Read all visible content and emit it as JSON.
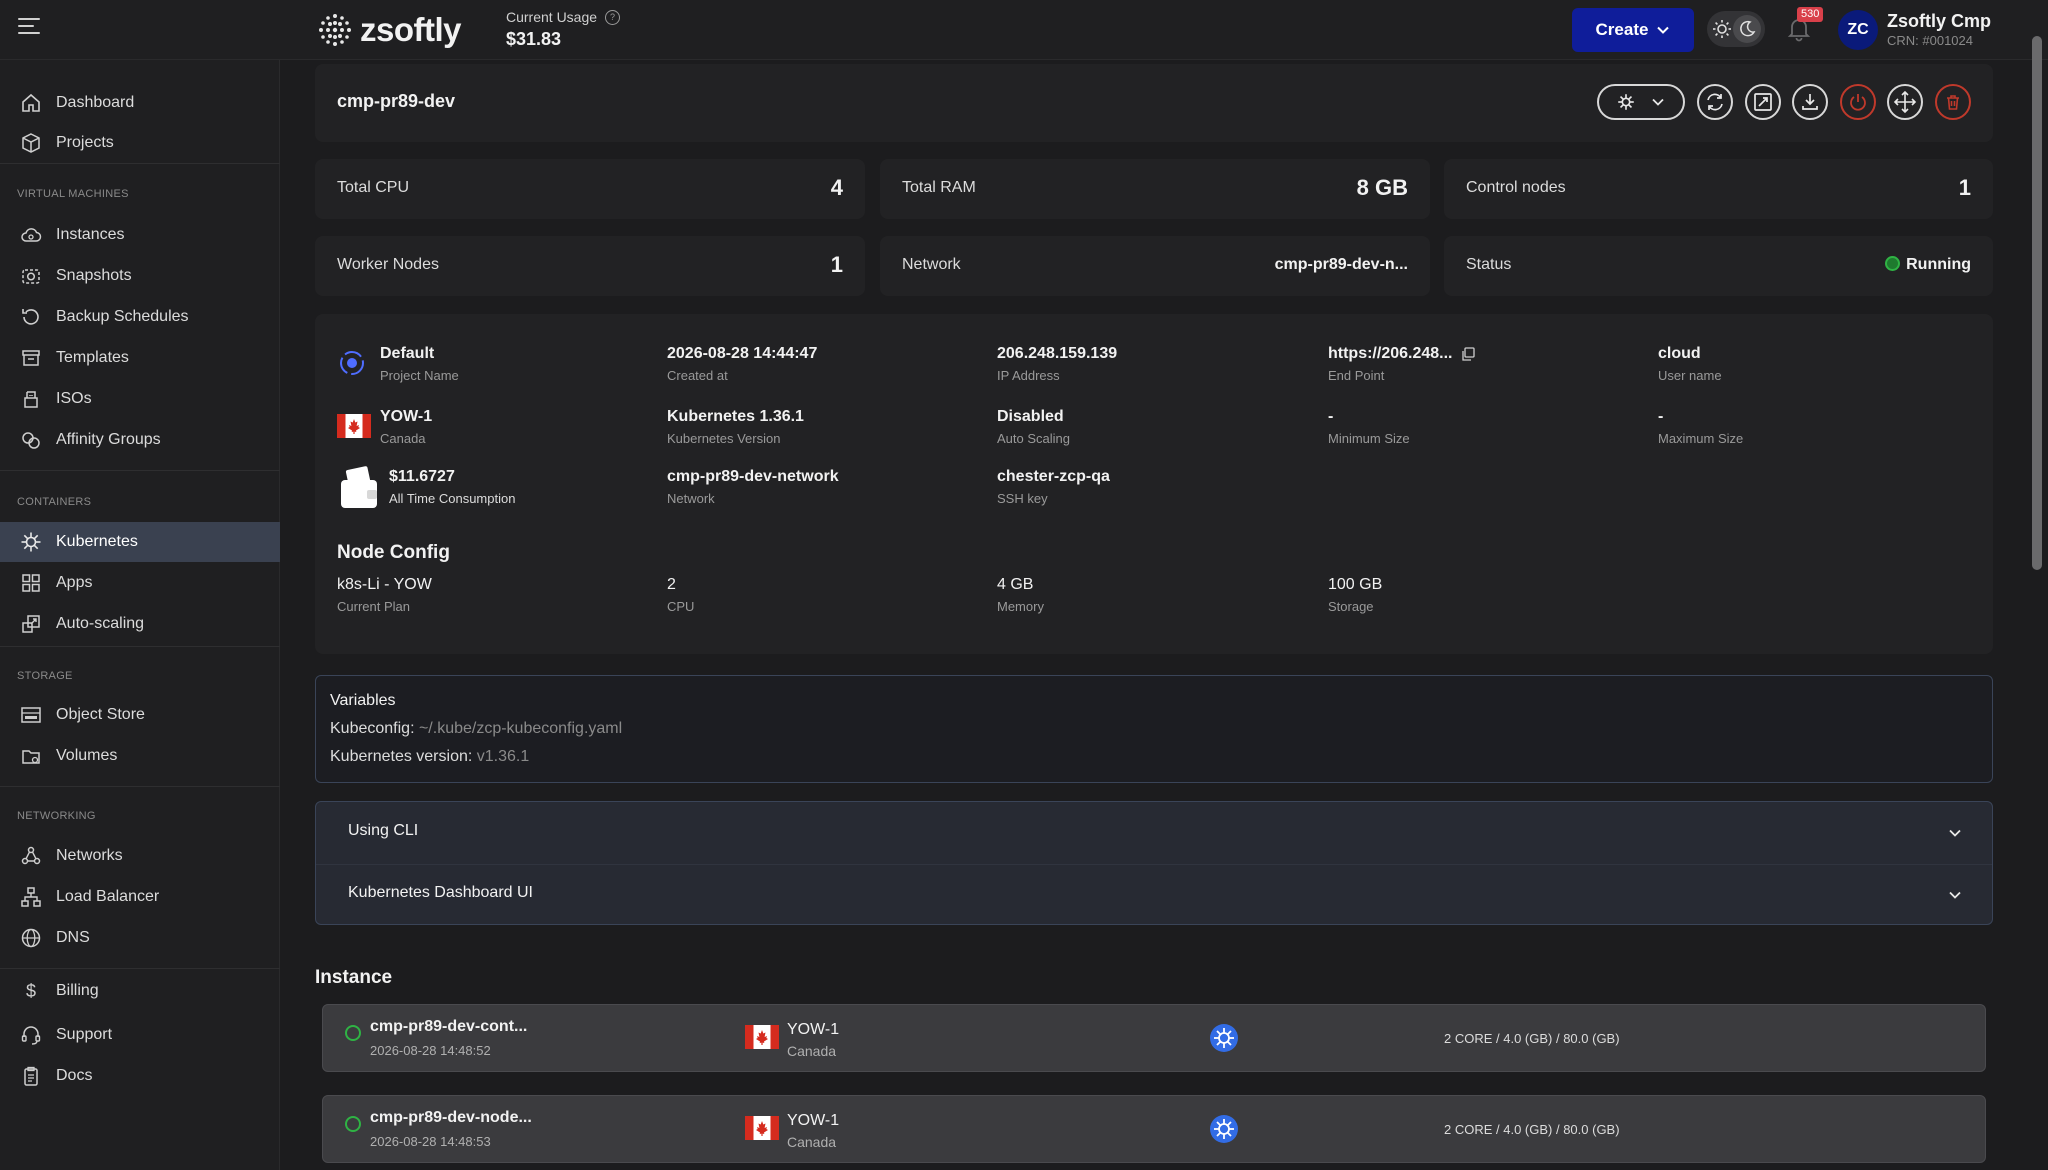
{
  "header": {
    "logo_text": "zsoftly",
    "usage_label": "Current Usage",
    "usage_value": "$31.83",
    "create_label": "Create",
    "notification_count": "530",
    "avatar_initials": "ZC",
    "user_name": "Zsoftly Cmp",
    "user_crn": "CRN: #001024"
  },
  "sidebar": {
    "top_items": [
      {
        "label": "Dashboard",
        "icon": "home-icon"
      },
      {
        "label": "Projects",
        "icon": "box-icon"
      }
    ],
    "sections": {
      "virtual_machines": "VIRTUAL MACHINES",
      "containers": "CONTAINERS",
      "storage": "STORAGE",
      "networking": "NETWORKING"
    },
    "vm_items": [
      {
        "label": "Instances"
      },
      {
        "label": "Snapshots"
      },
      {
        "label": "Backup Schedules"
      },
      {
        "label": "Templates"
      },
      {
        "label": "ISOs"
      },
      {
        "label": "Affinity Groups"
      }
    ],
    "container_items": [
      {
        "label": "Kubernetes",
        "active": true
      },
      {
        "label": "Apps"
      },
      {
        "label": "Auto-scaling"
      }
    ],
    "storage_items": [
      {
        "label": "Object Store"
      },
      {
        "label": "Volumes"
      }
    ],
    "networking_items": [
      {
        "label": "Networks"
      },
      {
        "label": "Load Balancer"
      },
      {
        "label": "DNS"
      }
    ],
    "bottom_items": [
      {
        "label": "Billing"
      },
      {
        "label": "Support"
      },
      {
        "label": "Docs"
      }
    ]
  },
  "cluster": {
    "name": "cmp-pr89-dev"
  },
  "stats": {
    "total_cpu": {
      "label": "Total CPU",
      "value": "4"
    },
    "total_ram": {
      "label": "Total RAM",
      "value": "8 GB"
    },
    "control_nodes": {
      "label": "Control nodes",
      "value": "1"
    },
    "worker_nodes": {
      "label": "Worker Nodes",
      "value": "1"
    },
    "network": {
      "label": "Network",
      "value": "cmp-pr89-dev-n..."
    },
    "status": {
      "label": "Status",
      "value": "Running"
    }
  },
  "details": {
    "project": {
      "value": "Default",
      "label": "Project Name"
    },
    "created": {
      "value": "2026-08-28 14:44:47",
      "label": "Created at"
    },
    "ip": {
      "value": "206.248.159.139",
      "label": "IP Address"
    },
    "endpoint": {
      "value": "https://206.248...",
      "label": "End Point"
    },
    "username": {
      "value": "cloud",
      "label": "User name"
    },
    "region": {
      "value": "YOW-1",
      "label": "Canada"
    },
    "k8s_version": {
      "value": "Kubernetes 1.36.1",
      "label": "Kubernetes Version"
    },
    "auto_scaling": {
      "value": "Disabled",
      "label": "Auto Scaling"
    },
    "min_size": {
      "value": "-",
      "label": "Minimum Size"
    },
    "max_size": {
      "value": "-",
      "label": "Maximum Size"
    },
    "consumption": {
      "value": "$11.6727",
      "label": "All Time Consumption"
    },
    "network": {
      "value": "cmp-pr89-dev-network",
      "label": "Network"
    },
    "ssh": {
      "value": "chester-zcp-qa",
      "label": "SSH key"
    }
  },
  "node_config": {
    "title": "Node Config",
    "plan": {
      "value": "k8s-Li - YOW",
      "label": "Current Plan"
    },
    "cpu": {
      "value": "2",
      "label": "CPU"
    },
    "memory": {
      "value": "4 GB",
      "label": "Memory"
    },
    "storage": {
      "value": "100 GB",
      "label": "Storage"
    }
  },
  "variables": {
    "title": "Variables",
    "kubeconfig_key": "Kubeconfig: ",
    "kubeconfig_val": "~/.kube/zcp-kubeconfig.yaml",
    "version_key": "Kubernetes version: ",
    "version_val": "v1.36.1"
  },
  "accordion": {
    "cli": "Using CLI",
    "dashboard": "Kubernetes Dashboard UI"
  },
  "instances": {
    "title": "Instance",
    "rows": [
      {
        "name": "cmp-pr89-dev-cont...",
        "date": "2026-08-28 14:48:52",
        "region": "YOW-1",
        "country": "Canada",
        "spec": "2 CORE / 4.0 (GB) / 80.0 (GB)"
      },
      {
        "name": "cmp-pr89-dev-node...",
        "date": "2026-08-28 14:48:53",
        "region": "YOW-1",
        "country": "Canada",
        "spec": "2 CORE / 4.0 (GB) / 80.0 (GB)"
      }
    ]
  },
  "colors": {
    "accent": "#0f1d9a",
    "status_running": "#2fb344",
    "danger": "#c0392b",
    "active_nav": "#3a4150"
  }
}
